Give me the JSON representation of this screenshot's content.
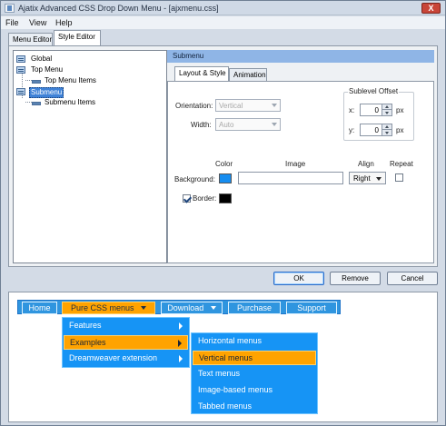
{
  "window": {
    "title": "Ajatix Advanced CSS Drop Down Menu - [ajxmenu.css]",
    "close_label": "X"
  },
  "menubar": {
    "items": [
      "File",
      "View",
      "Help"
    ]
  },
  "tabs": {
    "items": [
      "Menu Editor",
      "Style Editor"
    ],
    "selected": "Style Editor"
  },
  "tree": {
    "items": [
      "Global",
      "Top Menu",
      "Top Menu Items",
      "Submenu",
      "Submenu Items"
    ],
    "selected": "Submenu"
  },
  "section": {
    "title": "Submenu"
  },
  "inner_tabs": {
    "items": [
      "Layout & Style",
      "Animation"
    ],
    "selected": "Layout & Style"
  },
  "layout": {
    "orientation_label": "Orientation:",
    "orientation_value": "Vertical",
    "width_label": "Width:",
    "width_value": "Auto"
  },
  "sublevel_offset": {
    "legend": "Sublevel Offset",
    "x_label": "x:",
    "x_value": "0",
    "x_unit": "px",
    "y_label": "y:",
    "y_value": "0",
    "y_unit": "px"
  },
  "appearance": {
    "color_header": "Color",
    "image_header": "Image",
    "align_header": "Align",
    "repeat_header": "Repeat",
    "background_label": "Background:",
    "background_color": "#168df0",
    "image_value": "",
    "align_value": "Right",
    "repeat_checked": false,
    "border_label": "Border:",
    "border_checked": true,
    "border_color": "#000000"
  },
  "dialog_buttons": {
    "ok": "OK",
    "remove": "Remove",
    "cancel": "Cancel"
  },
  "preview": {
    "top_items": [
      "Home",
      "Pure CSS menus",
      "Download",
      "Purchase",
      "Support"
    ],
    "active_top": "Pure CSS menus",
    "submenu_items": [
      "Features",
      "Examples",
      "Dreamweaver extension"
    ],
    "active_submenu": "Examples",
    "nested_items": [
      "Horizontal menus",
      "Vertical menus",
      "Text menus",
      "Image-based menus",
      "Tabbed menus"
    ],
    "active_nested": "Vertical menus"
  },
  "colors": {
    "menu_blue": "#1694f5",
    "menu_orange": "#ffa300",
    "section_header": "#8fb5e6",
    "selection_blue": "#3f82d7"
  },
  "icons": {
    "app": "application-window-icon",
    "tree_group": "grid-icon",
    "tree_item": "menu-item-icon",
    "dropdown": "chevron-down-icon",
    "submenu": "chevron-right-icon"
  }
}
